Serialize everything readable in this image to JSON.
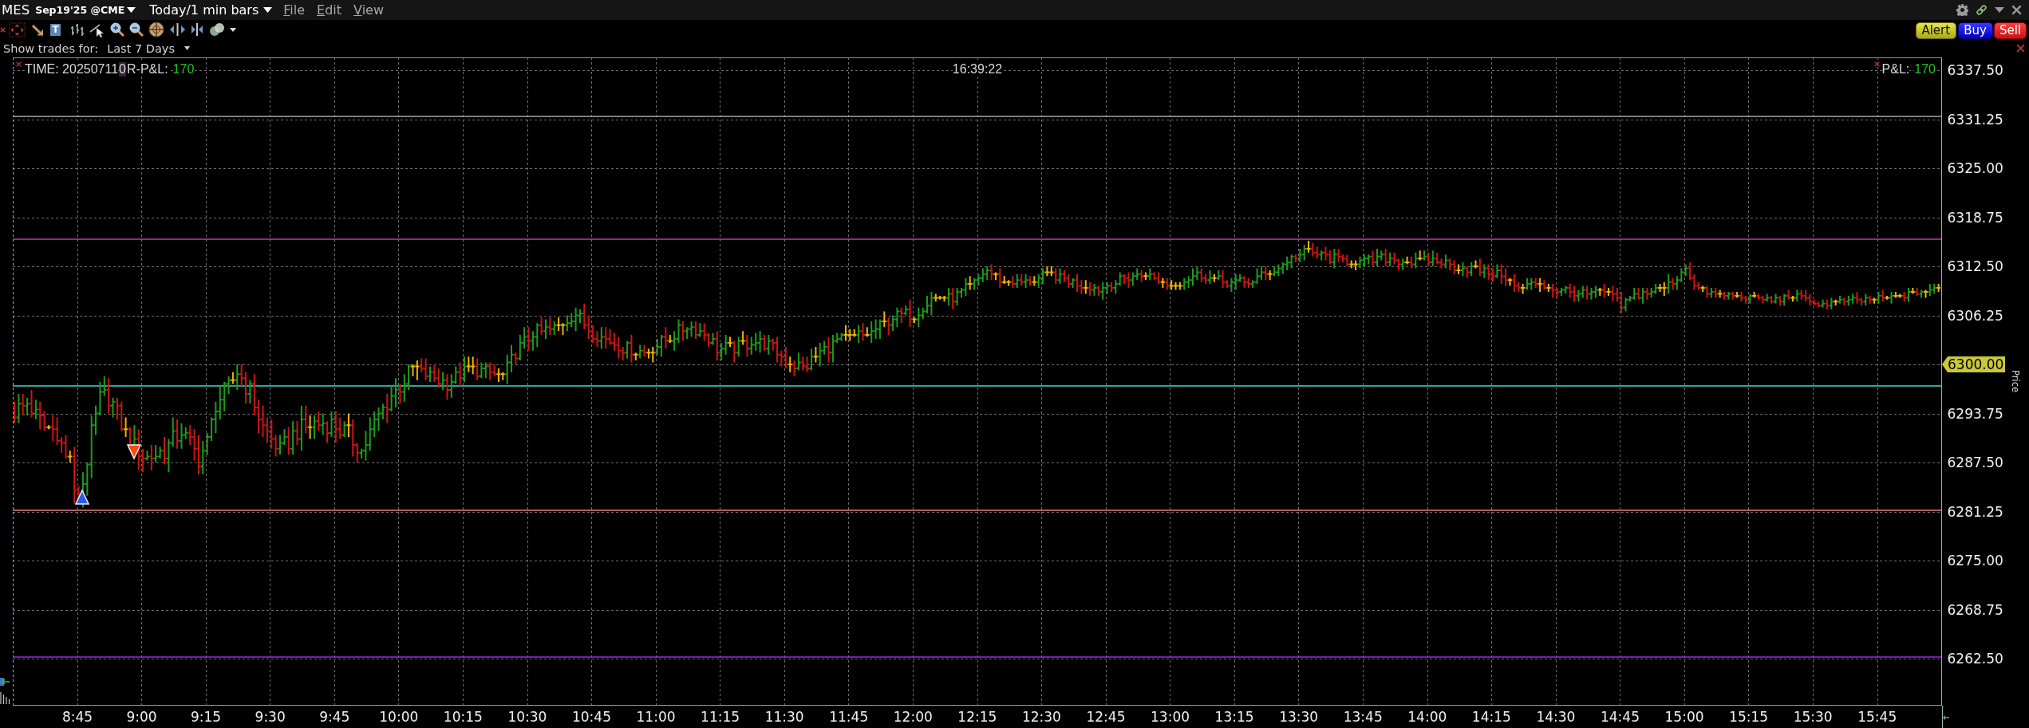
{
  "title_bar": {
    "symbol": "MES",
    "contract": "Sep19'25 @CME",
    "period": "Today/1 min bars",
    "menus": [
      "File",
      "Edit",
      "View"
    ]
  },
  "toolbar": {
    "text_tool": "T",
    "order_buttons": [
      {
        "label": "Alert",
        "kind": "alert"
      },
      {
        "label": "Buy",
        "kind": "buy"
      },
      {
        "label": "Sell",
        "kind": "sell"
      }
    ]
  },
  "trades_filter": {
    "label": "Show trades for:",
    "range": "Last 7 Days"
  },
  "chart": {
    "info": {
      "time": "TIME: 20250711",
      "flag": "0",
      "rpl_label": "R-P&L:",
      "rpl_value": "170"
    },
    "clock": "16:39:22",
    "pnl": {
      "label": "P&L:",
      "value": "170"
    },
    "price_axis": {
      "title": "Price",
      "labels": [
        {
          "text": "6337.50",
          "kind": "tick"
        },
        {
          "text": "6331.25",
          "kind": "tick"
        },
        {
          "text": "6325.00",
          "kind": "tick"
        },
        {
          "text": "6318.75",
          "kind": "tick"
        },
        {
          "text": "6312.50",
          "kind": "tick"
        },
        {
          "text": "6306.25",
          "kind": "tick"
        },
        {
          "text": "6300.00",
          "kind": "last_price"
        },
        {
          "text": "6293.75",
          "kind": "tick"
        },
        {
          "text": "6287.50",
          "kind": "tick"
        },
        {
          "text": "6281.25",
          "kind": "tick"
        },
        {
          "text": "6275.00",
          "kind": "tick"
        },
        {
          "text": "6268.75",
          "kind": "tick"
        },
        {
          "text": "6262.50",
          "kind": "tick"
        }
      ]
    },
    "time_axis": {
      "labels": [
        "8:45",
        "9:00",
        "9:15",
        "9:30",
        "9:45",
        "10:00",
        "10:15",
        "10:30",
        "10:45",
        "11:00",
        "11:15",
        "11:30",
        "11:45",
        "12:00",
        "12:15",
        "12:30",
        "12:45",
        "13:00",
        "13:15",
        "13:30",
        "13:45",
        "14:00",
        "14:15",
        "14:30",
        "14:45",
        "15:00",
        "15:15",
        "15:30",
        "15:45"
      ]
    }
  }
}
